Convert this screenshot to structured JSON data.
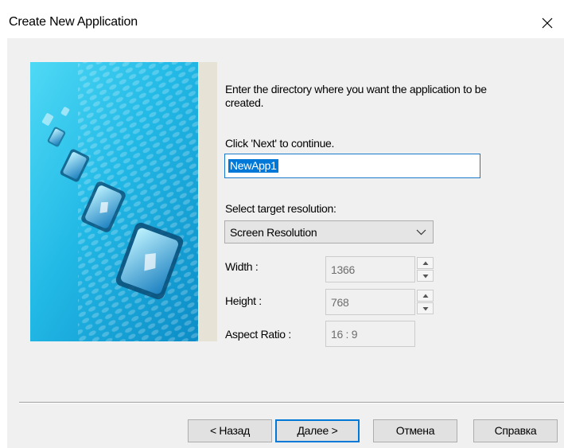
{
  "window": {
    "title": "Create New Application",
    "close_glyph": "✕"
  },
  "main": {
    "instruction": "Enter the directory where you want the application to be created.",
    "continue_hint": "Click 'Next' to continue.",
    "directory_value": "NewApp1",
    "resolution_label": "Select target resolution:",
    "resolution_selected": "Screen Resolution",
    "width_label": "Width :",
    "width_value": "1366",
    "height_label": "Height :",
    "height_value": "768",
    "aspect_label": "Aspect Ratio :",
    "aspect_value": "16 : 9"
  },
  "footer": {
    "back_label": "< Назад",
    "next_label": "Далее >",
    "cancel_label": "Отмена",
    "help_label": "Справка"
  },
  "icons": {
    "close": "close-icon",
    "dropdown": "chevron-down-icon",
    "spin_up": "spin-up-icon",
    "spin_down": "spin-down-icon",
    "banner": "wizard-banner-image"
  },
  "colors": {
    "accent": "#0078d7",
    "dialog_bg": "#f0f0f0",
    "banner_cyan": "#2bc6ec",
    "banner_strip": "#e6e2d6"
  }
}
